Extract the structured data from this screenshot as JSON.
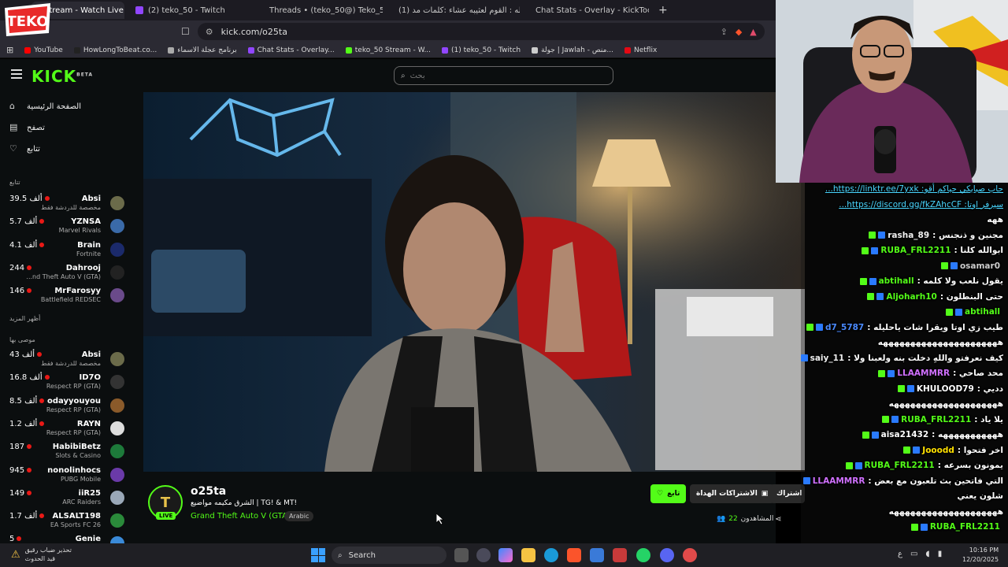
{
  "browser": {
    "tabs": [
      {
        "label": "Stream - Watch Live on",
        "fav_color": "#53fc18",
        "active": true
      },
      {
        "label": "(2) teko_50 - Twitch",
        "fav_color": "#9146ff",
        "active": false
      },
      {
        "label": "Threads • (teko_50@) Teko_50 قل",
        "fav_color": "#888888",
        "active": false
      },
      {
        "label": "(1) شيله : القوم لعثيبه عشاء :كلمات مد",
        "fav_color": "#ff0000",
        "active": false
      },
      {
        "label": "Chat Stats - Overlay - KickTools",
        "fav_color": "#9146ff",
        "active": false
      }
    ],
    "new_tab": "+",
    "url": "kick.com/o25ta",
    "bookmarks": [
      {
        "label": "YouTube",
        "color": "#ff0000"
      },
      {
        "label": "HowLongToBeat.co...",
        "color": "#222222"
      },
      {
        "label": "برنامج عجلة الاسماء",
        "color": "#aaaaaa"
      },
      {
        "label": "Chat Stats - Overlay...",
        "color": "#9146ff"
      },
      {
        "label": "teko_50 Stream - W...",
        "color": "#53fc18"
      },
      {
        "label": "(1) teko_50 - Twitch",
        "color": "#9146ff"
      },
      {
        "label": "جولة | Jawlah - منص...",
        "color": "#cccccc"
      },
      {
        "label": "Netflix",
        "color": "#e50914"
      }
    ]
  },
  "overlay_logo": "TEKO",
  "kick": {
    "logo": "KICK",
    "logo_beta": "BETA",
    "search_placeholder": "بحث",
    "nav": [
      {
        "label": "الصفحة الرئيسية",
        "icon": "home-icon",
        "glyph": "⌂"
      },
      {
        "label": "تصفح",
        "icon": "browse-icon",
        "glyph": "▤"
      },
      {
        "label": "تتابع",
        "icon": "heart-icon",
        "glyph": "♡"
      }
    ],
    "following_title": "تتابع",
    "following": [
      {
        "count": "39.5 ألف",
        "name": "Absi",
        "sub": "مخصصة للدردشة فقط",
        "color": "#6b6b4a"
      },
      {
        "count": "5.7 ألف",
        "name": "YZNSA",
        "sub": "Marvel Rivals",
        "color": "#3a6aa8"
      },
      {
        "count": "4.1 ألف",
        "name": "Brain",
        "sub": "Fortnite",
        "color": "#1b2a6b"
      },
      {
        "count": "244",
        "name": "Dahrooj",
        "sub": "...nd Theft Auto V (GTA)",
        "color": "#222222"
      },
      {
        "count": "146",
        "name": "MrFarosyy",
        "sub": "Battlefield REDSEC",
        "color": "#6a4a8a"
      }
    ],
    "show_more_1": "أظهر المزيد",
    "recommended_title": "موصى بها",
    "recommended": [
      {
        "count": "43 ألف",
        "name": "Absi",
        "sub": "مخصصة للدردشة فقط",
        "color": "#6b6b4a"
      },
      {
        "count": "16.8 ألف",
        "name": "ID7O",
        "sub": "Respect RP (GTA)",
        "color": "#333333"
      },
      {
        "count": "8.5 ألف",
        "name": "odayyouyou",
        "sub": "Respect RP (GTA)",
        "color": "#8a5a2a"
      },
      {
        "count": "1.2 ألف",
        "name": "RAYN",
        "sub": "Respect RP (GTA)",
        "color": "#dddddd"
      },
      {
        "count": "187",
        "name": "HabibiBetz",
        "sub": "Slots & Casino",
        "color": "#1d7a3a"
      },
      {
        "count": "945",
        "name": "nonolinhocs",
        "sub": "PUBG Mobile",
        "color": "#6a3aa8"
      },
      {
        "count": "149",
        "name": "iiR25",
        "sub": "ARC Raiders",
        "color": "#9aa8b8"
      },
      {
        "count": "1.7 ألف",
        "name": "ALSALT198",
        "sub": "EA Sports FC 26",
        "color": "#2a8a3a"
      },
      {
        "count": "5",
        "name": "Genie",
        "sub": "",
        "color": "#3a8ad8"
      }
    ],
    "channel": {
      "name": "o25ta",
      "avatar_text": "T",
      "live": "LIVE",
      "title": "الشرق مكيمه مواضيع | TG! & MT!",
      "category": "Grand Theft Auto V (GTA)",
      "language": "Arabic",
      "follow": "تابع",
      "gift": "الاشتراكات الهداة",
      "subscribe": "اشتراك",
      "viewers_label": "المشاهدون",
      "viewers_count": "22"
    }
  },
  "chat": [
    {
      "user": "",
      "text": "...https://linktr.ee/7yxk :حاب صبايكي حياكم أقو",
      "user_color": "#ffffff",
      "link": true
    },
    {
      "user": "",
      "text": "...https://discord.gg/fkZAhcCF :سيرفر اوتا",
      "user_color": "#ffffff",
      "link": true
    },
    {
      "user": "",
      "text": "ههه",
      "user_color": "#ffffff"
    },
    {
      "user": "rasha_89",
      "text": ": مجنين و ذنجنس",
      "user_color": "#f0f0f0"
    },
    {
      "user": "RUBA_FRL2211",
      "text": ": ابوالله كلنا",
      "user_color": "#53fc18"
    },
    {
      "user": "osamar0",
      "text": "",
      "user_color": "#cccccc"
    },
    {
      "user": "abtihall",
      "text": ": يقول نلعب ولا كلمه",
      "user_color": "#53fc18"
    },
    {
      "user": "Aljoharh10",
      "text": ": حتى البنطلون",
      "user_color": "#53fc18"
    },
    {
      "user": "abtihall",
      "text": "",
      "user_color": "#53fc18"
    },
    {
      "user": "d7_5787",
      "text": ": طيب زي اوتا ويقرا شات ياحليله",
      "user_color": "#4a8aff"
    },
    {
      "user": "",
      "text": "ههههههههههههههههههههههه",
      "user_color": "#ffffff"
    },
    {
      "user": "saiy_11",
      "text": ": كيف نعرفتو واللهِ دخلت بنه ولعبنا ولا",
      "user_color": "#f0f0f0"
    },
    {
      "user": "LLAAMMRR",
      "text": ": محد صاحي",
      "user_color": "#d070ff"
    },
    {
      "user": "KHULOOD79",
      "text": ": دديي",
      "user_color": "#ffffff"
    },
    {
      "user": "",
      "text": "ههههههههههههههههههههه",
      "user_color": "#ffffff"
    },
    {
      "user": "RUBA_FRL2211",
      "text": ": يلا ياد",
      "user_color": "#53fc18"
    },
    {
      "user": "aisa21432",
      "text": ": هههههههههههه",
      "user_color": "#ffffff"
    },
    {
      "user": "Jooodd",
      "text": ": اخر فتحوا",
      "user_color": "#ffe000"
    },
    {
      "user": "RUBA_FRL2211",
      "text": ": يمونون بسرعه",
      "user_color": "#53fc18"
    },
    {
      "user": "LLAAMMRR",
      "text": ": التي فاتحين بث تلعبون مع بعض",
      "user_color": "#d070ff"
    },
    {
      "user": "",
      "text": "شلون يعني",
      "user_color": "#ffffff"
    },
    {
      "user": "",
      "text": "ههههههههههههههههههههه",
      "user_color": "#ffffff"
    },
    {
      "user": "RUBA_FRL2211",
      "text": "",
      "user_color": "#53fc18"
    }
  ],
  "taskbar": {
    "weather_title": "تحذير ضباب رقيق",
    "weather_sub": "قيد الحدوث",
    "search": "Search",
    "time": "10:16 PM",
    "date": "12/20/2025",
    "lang": "ع"
  },
  "colors": {
    "kick_green": "#53fc18",
    "bg": "#0b0e0f"
  }
}
